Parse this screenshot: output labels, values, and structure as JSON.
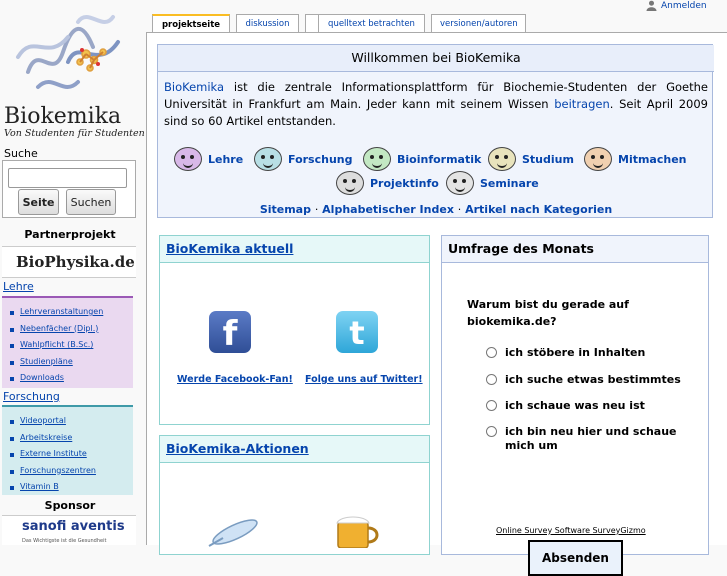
{
  "logo": {
    "name": "Biokemika",
    "tagline": "Von Studenten für Studenten"
  },
  "search": {
    "heading": "Suche",
    "placeholder": "",
    "page_button": "Seite",
    "search_button": "Suchen"
  },
  "partner": {
    "title": "Partnerprojekt",
    "name": "BioPhysika.de"
  },
  "nav": {
    "lehre": {
      "title": "Lehre",
      "items": [
        "Lehrveranstaltungen",
        "Nebenfächer (Dipl.)",
        "Wahlpflicht (B.Sc.)",
        "Studienpläne",
        "Downloads"
      ]
    },
    "forschung": {
      "title": "Forschung",
      "items": [
        "Videoportal",
        "Arbeitskreise",
        "Externe Institute",
        "Forschungszentren",
        "Vitamin B"
      ]
    }
  },
  "sponsor": {
    "title": "Sponsor",
    "name": "sanofi aventis",
    "sub": "Das Wichtigste ist die Gesundheit"
  },
  "user": {
    "login": "Anmelden"
  },
  "tabs": [
    "projektseite",
    "diskussion",
    "",
    "quelltext betrachten",
    "versionen/autoren"
  ],
  "welcome": {
    "title": "Willkommen bei BioKemika",
    "brand": "BioKemika",
    "text_a": " ist die zentrale Informationsplattform für Biochemie-Studenten der Goethe Universität in Frankfurt am Main. Jeder kann mit seinem Wissen ",
    "contribute": "beitragen",
    "text_b": ". Seit April 2009 sind so 60 Artikel entstanden.",
    "portals": [
      "Lehre",
      "Forschung",
      "Bioinformatik",
      "Studium",
      "Mitmachen",
      "Projektinfo",
      "Seminare"
    ],
    "links": [
      "Sitemap",
      "Alphabetischer Index",
      "Artikel nach Kategorien"
    ],
    "separator": "·"
  },
  "aktuell": {
    "title": "BioKemika aktuell",
    "facebook": "Werde Facebook-Fan!",
    "twitter": "Folge uns auf Twitter!"
  },
  "aktionen": {
    "title": "BioKemika-Aktionen"
  },
  "umfrage": {
    "title": "Umfrage des Monats",
    "question": "Warum bist du gerade auf biokemika.de?",
    "options": [
      "ich stöbere in Inhalten",
      "ich suche etwas bestimmtes",
      "ich schaue was neu ist",
      "ich bin neu hier und schaue mich um"
    ],
    "credit": "Online Survey Software SurveyGizmo",
    "submit": "Absenden"
  }
}
